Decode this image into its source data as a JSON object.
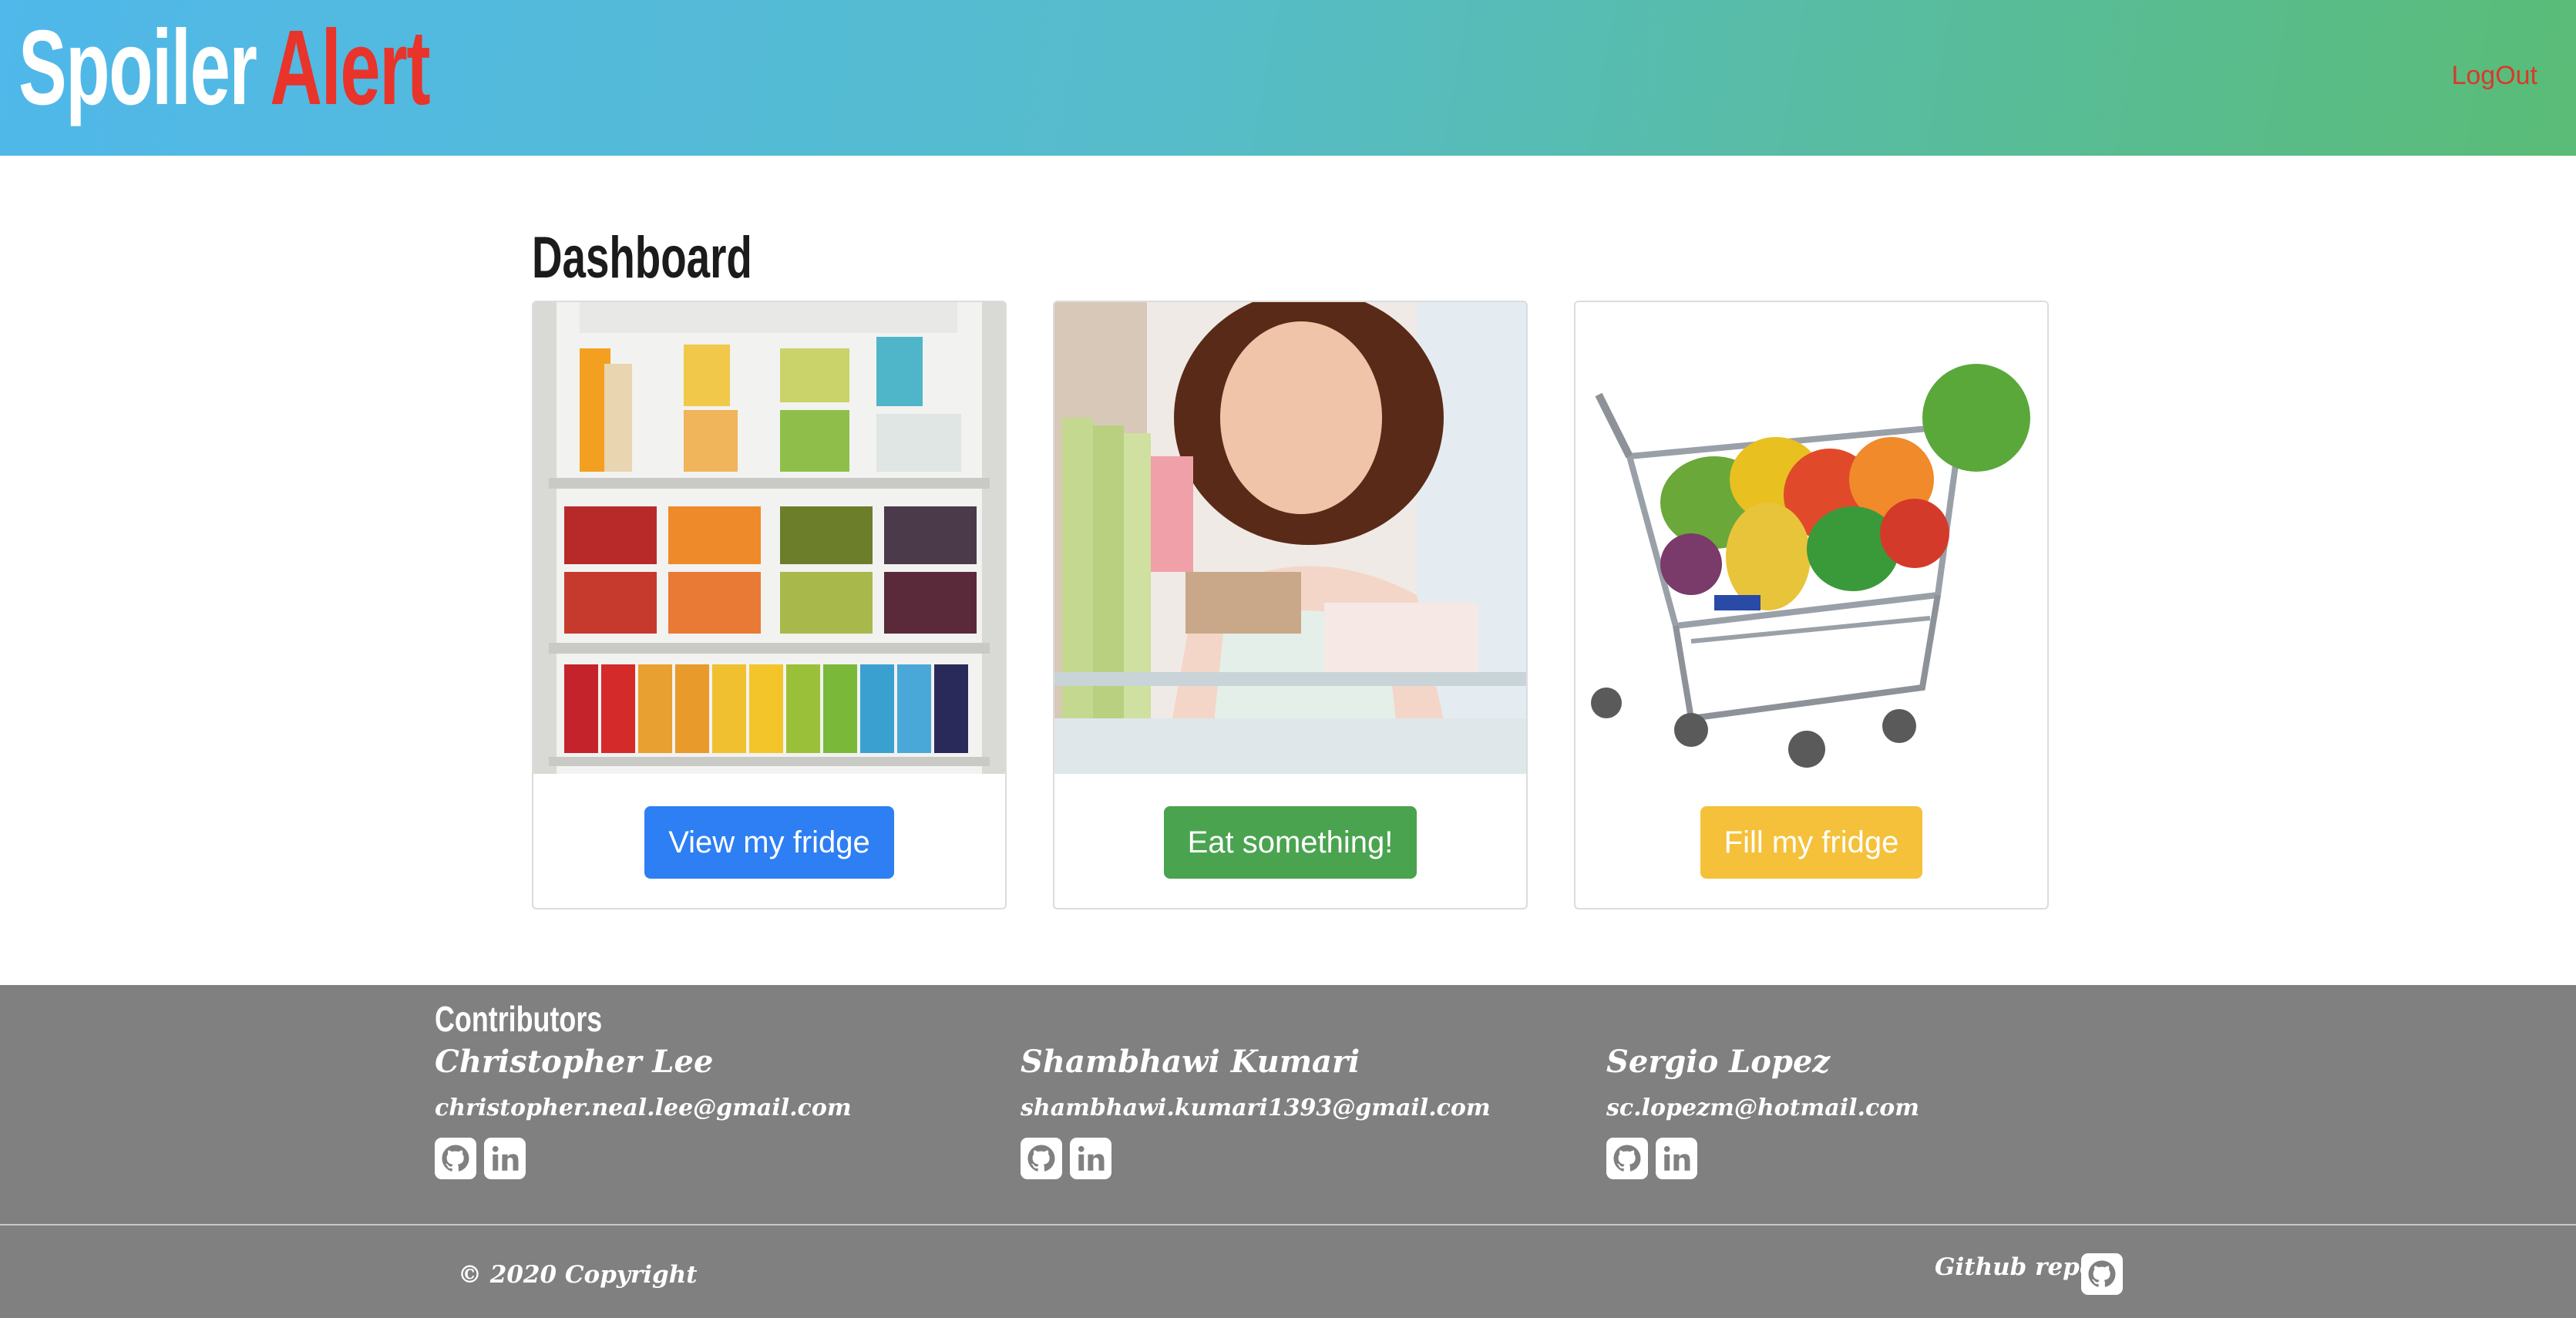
{
  "header": {
    "brand_word1": "Spoiler",
    "brand_word2": "Alert",
    "logout_label": "LogOut"
  },
  "main": {
    "title": "Dashboard",
    "cards": [
      {
        "image": "fridge-contents-photo",
        "button_label": "View my fridge",
        "button_color": "#2d7ff3"
      },
      {
        "image": "woman-eating-photo",
        "button_label": "Eat something!",
        "button_color": "#4aa34f"
      },
      {
        "image": "grocery-cart-photo",
        "button_label": "Fill my fridge",
        "button_color": "#f5c13a"
      }
    ]
  },
  "footer": {
    "contributors_title": "Contributors",
    "contributors": [
      {
        "name": "Christopher Lee",
        "email": "christopher.neal.lee@gmail.com",
        "icons": [
          "github-icon",
          "linkedin-icon"
        ]
      },
      {
        "name": "Shambhawi Kumari",
        "email": "shambhawi.kumari1393@gmail.com",
        "icons": [
          "github-icon",
          "linkedin-icon"
        ]
      },
      {
        "name": "Sergio Lopez",
        "email": "sc.lopezm@hotmail.com",
        "icons": [
          "github-icon",
          "linkedin-icon"
        ]
      }
    ],
    "copyright": "© 2020 Copyright",
    "repo_label": "Github repo"
  },
  "colors": {
    "header_gradient_start": "#50b8ea",
    "header_gradient_end": "#5abc76",
    "brand_accent": "#e8342b",
    "logout": "#d73a2c",
    "footer_bg": "#808080"
  }
}
